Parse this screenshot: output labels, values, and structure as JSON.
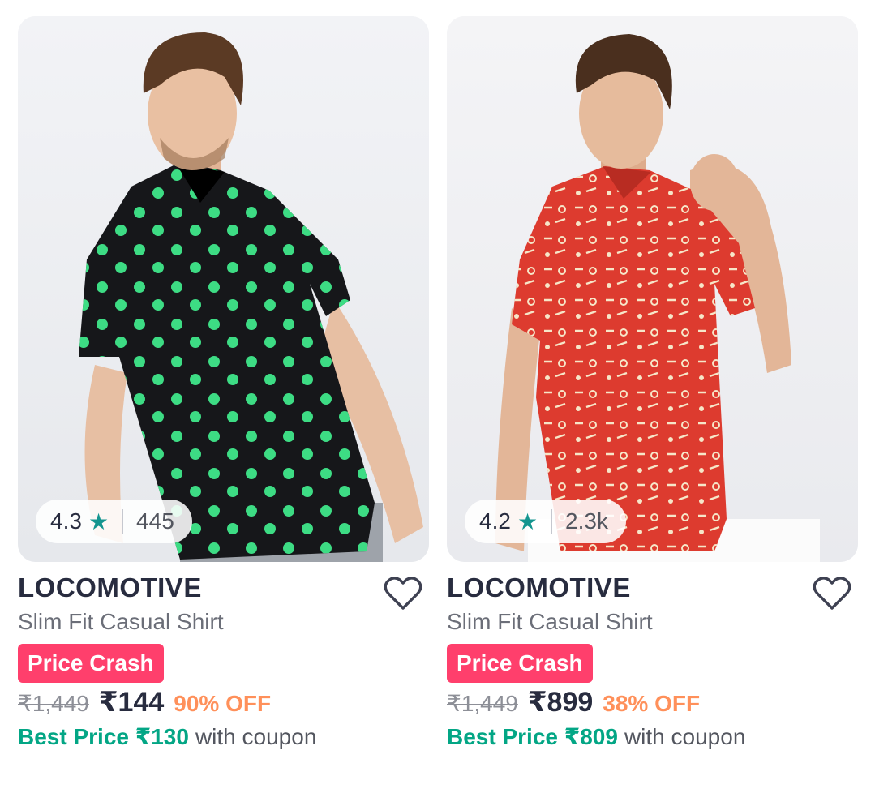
{
  "colors": {
    "brand_pink": "#ff3f6c",
    "discount_orange": "#ff905a",
    "best_price_green": "#03a685",
    "rating_star_teal": "#14958f",
    "text_dark": "#282c3f",
    "text_muted": "#6b6e78"
  },
  "products": [
    {
      "rating": "4.3",
      "rating_icon": "star-icon",
      "rating_count": "445",
      "brand": "LOCOMOTIVE",
      "name": "Slim Fit Casual Shirt",
      "badge": "Price Crash",
      "mrp": "₹1,449",
      "price": "₹144",
      "discount": "90% OFF",
      "best_price_label": "Best Price ₹130",
      "best_price_suffix": "with coupon",
      "wishlist_icon": "heart-outline-icon",
      "shirt_color": "#16171a",
      "print_color": "#3ddc84"
    },
    {
      "rating": "4.2",
      "rating_icon": "star-icon",
      "rating_count": "2.3k",
      "brand": "LOCOMOTIVE",
      "name": "Slim Fit Casual Shirt",
      "badge": "Price Crash",
      "mrp": "₹1,449",
      "price": "₹899",
      "discount": "38% OFF",
      "best_price_label": "Best Price ₹809",
      "best_price_suffix": "with coupon",
      "wishlist_icon": "heart-outline-icon",
      "shirt_color": "#dd3b2f",
      "print_color": "#f6e6c8"
    }
  ]
}
